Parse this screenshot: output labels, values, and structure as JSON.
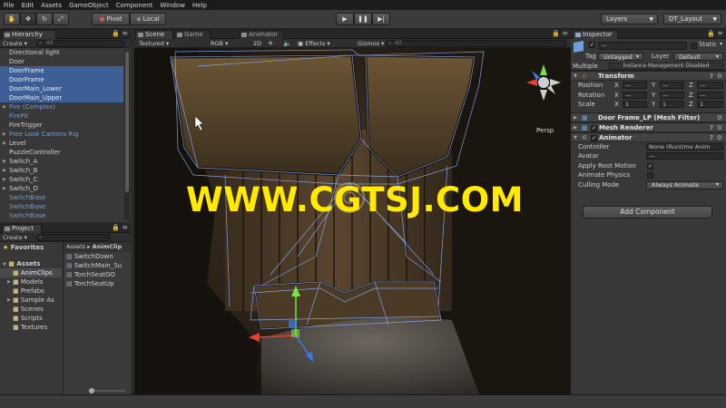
{
  "menu": [
    "File",
    "Edit",
    "Assets",
    "GameObject",
    "Component",
    "Window",
    "Help"
  ],
  "toolbar": {
    "pivot": "Pivot",
    "local": "Local",
    "layers": "Layers",
    "layout": "DT_Layout"
  },
  "hierarchy": {
    "tab": "Hierarchy",
    "create": "Create",
    "search_placeholder": "All",
    "items": [
      {
        "label": "Directional light",
        "state": "normal"
      },
      {
        "label": "Door",
        "state": "normal"
      },
      {
        "label": "DoorFrame",
        "state": "selected"
      },
      {
        "label": "DoorFrame",
        "state": "selected"
      },
      {
        "label": "DoorMain_Lower",
        "state": "selected"
      },
      {
        "label": "DoorMain_Upper",
        "state": "selected"
      },
      {
        "label": "Fire (Complex)",
        "state": "prefab",
        "arrow": true
      },
      {
        "label": "FirePit",
        "state": "prefab"
      },
      {
        "label": "FireTrigger",
        "state": "normal"
      },
      {
        "label": "Free Look Camera Rig",
        "state": "prefab",
        "arrow": true
      },
      {
        "label": "Level",
        "state": "normal",
        "arrow": true
      },
      {
        "label": "PuzzleController",
        "state": "normal"
      },
      {
        "label": "Switch_A",
        "state": "normal",
        "arrow": true
      },
      {
        "label": "Switch_B",
        "state": "normal",
        "arrow": true
      },
      {
        "label": "Switch_C",
        "state": "normal",
        "arrow": true
      },
      {
        "label": "Switch_D",
        "state": "normal",
        "arrow": true
      },
      {
        "label": "SwitchBase",
        "state": "prefab"
      },
      {
        "label": "SwitchBase",
        "state": "prefab"
      },
      {
        "label": "SwitchBase",
        "state": "prefab"
      }
    ]
  },
  "project": {
    "tab": "Project",
    "create": "Create",
    "favorites": "Favorites",
    "assets": "Assets",
    "breadcrumb_root": "Assets",
    "breadcrumb_folder": "AnimClip",
    "folders": [
      "AnimClips",
      "Models",
      "Prefabs",
      "Sample As",
      "Scenes",
      "Scripts",
      "Textures"
    ],
    "files": [
      "SwitchDown",
      "SwitchMain_Su",
      "TorchSeatGO",
      "TorchSeatUp"
    ]
  },
  "scene": {
    "tabs": [
      "Scene",
      "Game",
      "Animator"
    ],
    "shading": "Textured",
    "rgb": "RGB",
    "mode_2d": "2D",
    "effects": "Effects",
    "gizmos": "Gizmos",
    "search_placeholder": "All",
    "persp": "Persp"
  },
  "inspector": {
    "tab": "Inspector",
    "static_label": "Static",
    "tag_label": "Tag",
    "tag_value": "Untagged",
    "layer_label": "Layer",
    "layer_value": "Default",
    "multiple_label": "Multiple",
    "multiple_value": "Instance Management Disabled",
    "transform": {
      "title": "Transform",
      "position": "Position",
      "rotation": "Rotation",
      "scale": "Scale",
      "dash": "—",
      "x": "X",
      "y": "Y",
      "z": "Z",
      "scale_x": "1",
      "scale_y": "1",
      "scale_z": "1"
    },
    "mesh_filter": "Door Frame_LP (Mesh Filter)",
    "mesh_renderer": "Mesh Renderer",
    "animator": {
      "title": "Animator",
      "controller_label": "Controller",
      "controller_value": "None (Runtime Anim",
      "avatar_label": "Avatar",
      "avatar_value": "—",
      "apply_root_motion": "Apply Root Motion",
      "animate_physics": "Animate Physics",
      "culling_mode_label": "Culling Mode",
      "culling_mode_value": "Always Animate"
    },
    "add_component": "Add Component"
  },
  "watermark": "WWW.CGTSJ.COM",
  "colors": {
    "selection": "#3e5f96",
    "prefab_text": "#6f9cd8",
    "watermark": "#ffea00",
    "wireframe": "#8fb4ff"
  }
}
